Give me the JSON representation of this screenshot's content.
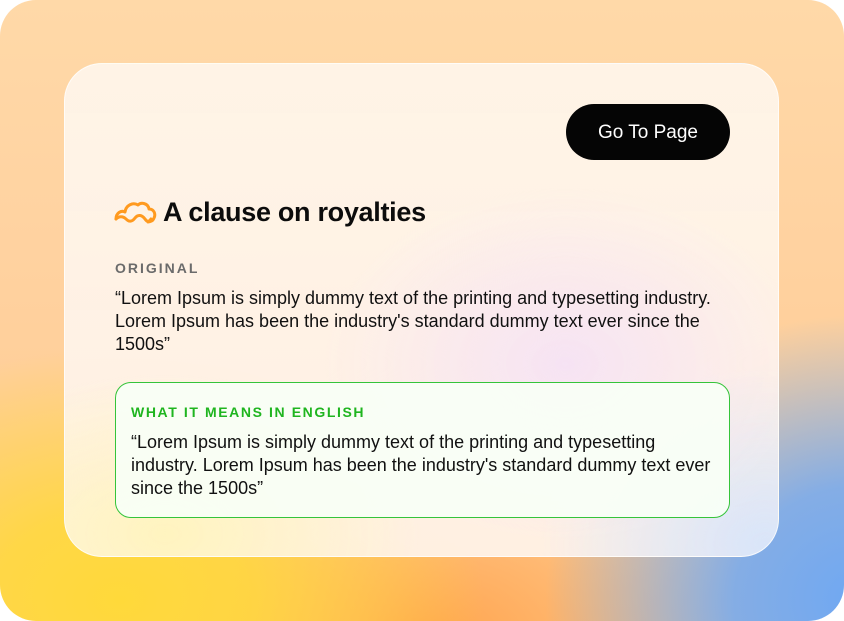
{
  "header": {
    "go_to_page_label": "Go To Page"
  },
  "clause": {
    "icon": "cloud-outline-icon",
    "title": "A clause on royalties"
  },
  "original": {
    "label": "ORIGINAL",
    "text": "“Lorem Ipsum is simply dummy text of the printing and typesetting industry. Lorem Ipsum has been the industry's standard dummy text ever since the 1500s”"
  },
  "meaning": {
    "label": "WHAT IT MEANS IN ENGLISH",
    "text": "“Lorem Ipsum is simply dummy text of the printing and typesetting industry. Lorem Ipsum has been the industry's standard dummy text ever since the 1500s”"
  },
  "colors": {
    "accent_orange": "#ff9a1f",
    "accent_green": "#1fb51f",
    "button_bg": "#050505"
  }
}
